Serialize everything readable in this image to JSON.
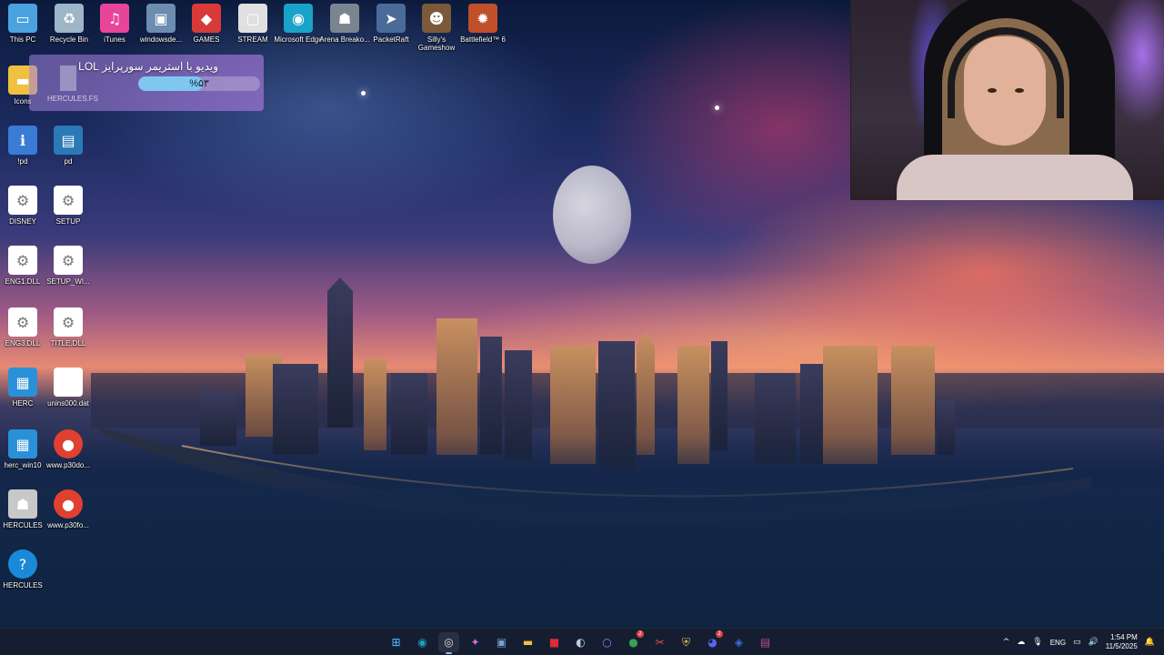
{
  "desktop_icons": [
    {
      "label": "This PC",
      "icon": "monitor-icon",
      "color": "#4aa3df"
    },
    {
      "label": "Recycle Bin",
      "icon": "recycle-bin-icon",
      "color": "#9fb6c8"
    },
    {
      "label": "iTunes",
      "icon": "itunes-icon",
      "color": "#e8459a"
    },
    {
      "label": "windowsde...",
      "icon": "installer-icon",
      "color": "#6c8cb0"
    },
    {
      "label": "GAMES",
      "icon": "games-icon",
      "color": "#d83a3a"
    },
    {
      "label": "STREAM",
      "icon": "stream-icon",
      "color": "#e0e0e0"
    },
    {
      "label": "Microsoft Edge",
      "icon": "edge-icon",
      "color": "#1aa3c8"
    },
    {
      "label": "Arena Breako...",
      "icon": "arena-breakout-icon",
      "color": "#7a8590"
    },
    {
      "label": "PacketRaft",
      "icon": "packetraft-icon",
      "color": "#4a6b9a"
    },
    {
      "label": "Silly's Gameshow",
      "icon": "sillys-gameshow-icon",
      "color": "#7a5a3a"
    },
    {
      "label": "Battlefield™ 6",
      "icon": "battlefield-icon",
      "color": "#c0502a"
    },
    {
      "label": "Icons",
      "icon": "folder-icon",
      "color": "#f0c040"
    },
    {
      "label": "!pd",
      "icon": "setup-info-icon",
      "color": "#3a7bd5"
    },
    {
      "label": "pd",
      "icon": "document-image-icon",
      "color": "#2a7ab8"
    },
    {
      "label": "DISNEY",
      "icon": "settings-file-icon",
      "color": "#ffffff"
    },
    {
      "label": "SETUP",
      "icon": "settings-file-icon",
      "color": "#ffffff"
    },
    {
      "label": "ENG1.DLL",
      "icon": "dll-file-icon",
      "color": "#ffffff"
    },
    {
      "label": "SETUP_WI...",
      "icon": "dll-file-icon",
      "color": "#ffffff"
    },
    {
      "label": "ENG3.DLL",
      "icon": "dll-file-icon",
      "color": "#ffffff"
    },
    {
      "label": "TITLE.DLL",
      "icon": "dll-file-icon",
      "color": "#ffffff"
    },
    {
      "label": "HERC",
      "icon": "herc-icon",
      "color": "#2a90d8"
    },
    {
      "label": "unins000.dat",
      "icon": "blank-file-icon",
      "color": "#ffffff"
    },
    {
      "label": "herc_win10",
      "icon": "herc-icon",
      "color": "#2a90d8"
    },
    {
      "label": "www.p30do...",
      "icon": "chrome-icon",
      "color": "#e04030"
    },
    {
      "label": "HERCULES",
      "icon": "hercules-icon",
      "color": "#c8c8c8"
    },
    {
      "label": "www.p30fo...",
      "icon": "chrome-icon",
      "color": "#e04030"
    },
    {
      "label": "HERCULES",
      "icon": "help-icon",
      "color": "#1a8ad8"
    }
  ],
  "overlay": {
    "title": "ویدیو با استریمر سورپرایز LOL",
    "percent_text": "%۵۳",
    "progress": 0.53,
    "subtitle": "HERCULES.FS"
  },
  "taskbar": {
    "apps": [
      {
        "name": "start-button",
        "icon": "windows-icon",
        "glyph": "⊞",
        "color": "#4cc2ff",
        "active": false
      },
      {
        "name": "taskbar-edge",
        "icon": "edge-icon",
        "glyph": "◉",
        "color": "#1aa3c8",
        "active": false
      },
      {
        "name": "taskbar-obs",
        "icon": "obs-icon",
        "glyph": "◎",
        "color": "#dddddd",
        "active": true,
        "badge": ""
      },
      {
        "name": "taskbar-copilot",
        "icon": "copilot-icon",
        "glyph": "✦",
        "color": "#d86bd0",
        "active": false
      },
      {
        "name": "taskbar-setup",
        "icon": "installer-icon",
        "glyph": "▣",
        "color": "#7aa0d0",
        "active": false
      },
      {
        "name": "taskbar-explorer",
        "icon": "folder-icon",
        "glyph": "▬",
        "color": "#f0c040",
        "active": false
      },
      {
        "name": "taskbar-app-red",
        "icon": "red-app-icon",
        "glyph": "■",
        "color": "#e02a3a",
        "active": false
      },
      {
        "name": "taskbar-steam",
        "icon": "steam-icon",
        "glyph": "◐",
        "color": "#c0d0e0",
        "active": false
      },
      {
        "name": "taskbar-purple",
        "icon": "ring-app-icon",
        "glyph": "○",
        "color": "#b070ff",
        "active": false
      },
      {
        "name": "taskbar-chrome",
        "icon": "chrome-icon",
        "glyph": "●",
        "color": "#3aa050",
        "active": false,
        "badge": "2"
      },
      {
        "name": "taskbar-snip",
        "icon": "snipping-tool-icon",
        "glyph": "✂",
        "color": "#e04a4a",
        "active": false
      },
      {
        "name": "taskbar-vpn",
        "icon": "shield-icon",
        "glyph": "⛨",
        "color": "#e0c060",
        "active": false
      },
      {
        "name": "taskbar-discord",
        "icon": "discord-icon",
        "glyph": "◕",
        "color": "#5865f2",
        "active": false,
        "badge": "2"
      },
      {
        "name": "taskbar-nord",
        "icon": "blue-app-icon",
        "glyph": "◈",
        "color": "#3a70e0",
        "active": false
      },
      {
        "name": "taskbar-winrar",
        "icon": "archive-icon",
        "glyph": "▤",
        "color": "#c04a8a",
        "active": false
      }
    ],
    "tray": {
      "chevron": "^",
      "language": "ENG",
      "time": "1:54 PM",
      "date": "11/5/2025"
    }
  }
}
